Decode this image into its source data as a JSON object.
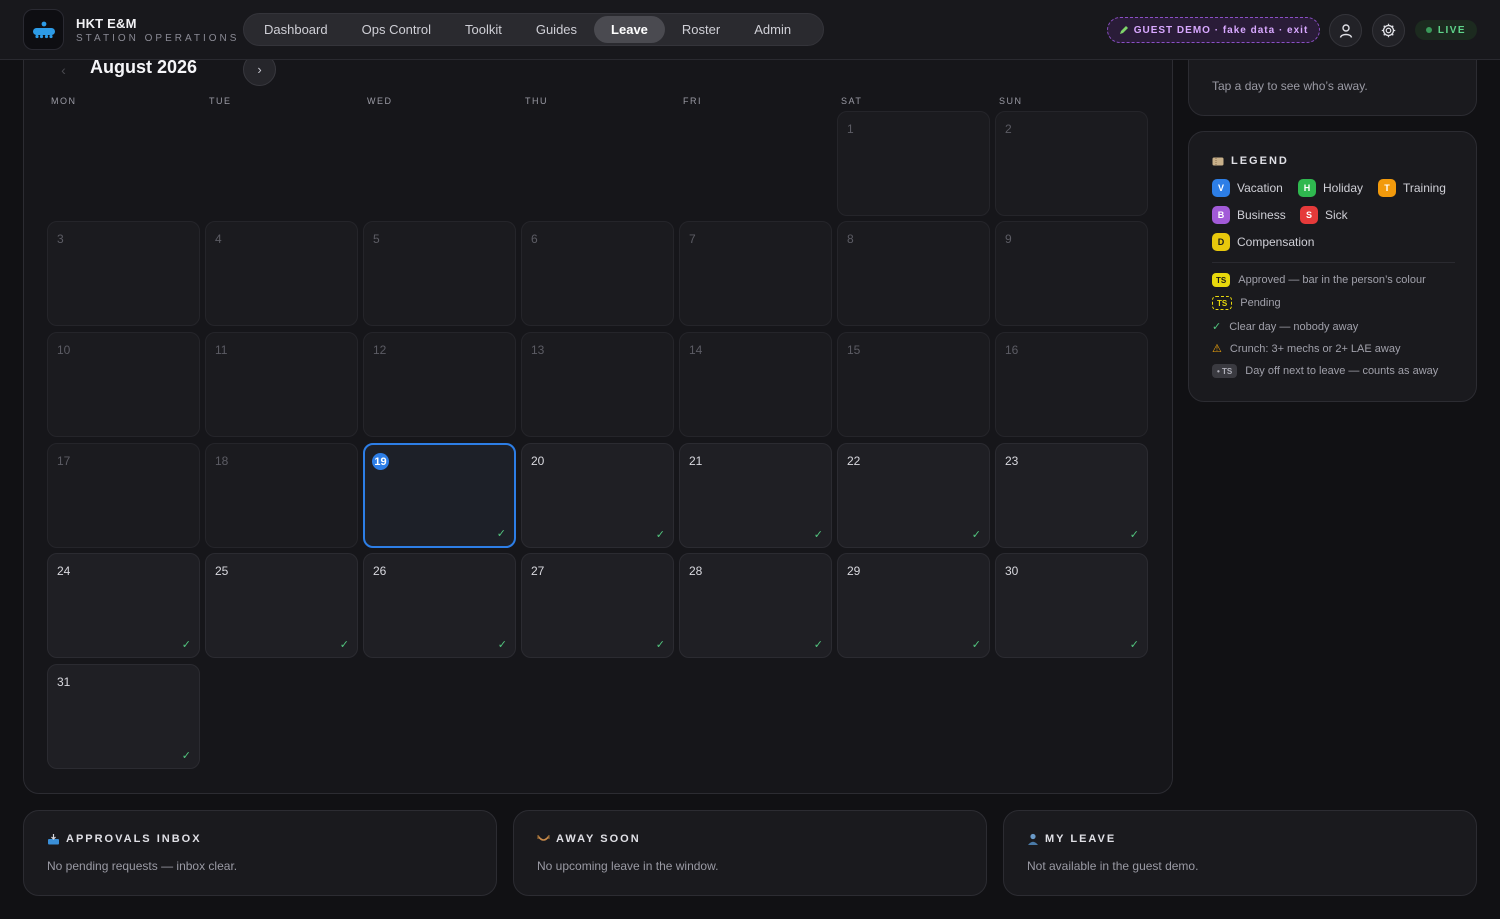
{
  "brand": {
    "title": "HKT E&M",
    "subtitle": "STATION OPERATIONS"
  },
  "nav": [
    {
      "label": "Dashboard",
      "active": false
    },
    {
      "label": "Ops Control",
      "active": false
    },
    {
      "label": "Toolkit",
      "active": false
    },
    {
      "label": "Guides",
      "active": false
    },
    {
      "label": "Leave",
      "active": true
    },
    {
      "label": "Roster",
      "active": false
    },
    {
      "label": "Admin",
      "active": false
    }
  ],
  "guest_banner": "GUEST DEMO · fake data · exit",
  "live": "LIVE",
  "calendar": {
    "month_label": "August 2026",
    "prev": "‹",
    "next": "›",
    "weekdays": [
      "MON",
      "TUE",
      "WED",
      "THU",
      "FRI",
      "SAT",
      "SUN"
    ],
    "today": 19,
    "days": [
      1,
      2,
      3,
      4,
      5,
      6,
      7,
      8,
      9,
      10,
      11,
      12,
      13,
      14,
      15,
      16,
      17,
      18,
      19,
      20,
      21,
      22,
      23,
      24,
      25,
      26,
      27,
      28,
      29,
      30,
      31
    ]
  },
  "day_detail": {
    "hint": "Tap a day to see who’s away."
  },
  "legend": {
    "title": "LEGEND",
    "types": [
      {
        "code": "V",
        "label": "Vacation",
        "color": "#2d7ee6"
      },
      {
        "code": "H",
        "label": "Holiday",
        "color": "#2fb84f"
      },
      {
        "code": "T",
        "label": "Training",
        "color": "#f29a0c"
      },
      {
        "code": "B",
        "label": "Business",
        "color": "#a25ad8"
      },
      {
        "code": "S",
        "label": "Sick",
        "color": "#e53a3a"
      },
      {
        "code": "D",
        "label": "Compensation",
        "color": "#e8c80c"
      }
    ],
    "approved_badge": "TS",
    "approved": "Approved — bar in the person’s colour",
    "pending_badge": "TS",
    "pending": "Pending",
    "clear_icon": "✓",
    "clear": "Clear day — nobody away",
    "crunch_icon": "⚠",
    "crunch": "Crunch: 3+ mechs or 2+ LAE away",
    "dayoff_badge": "• TS",
    "dayoff": "Day off next to leave — counts as away"
  },
  "cards": {
    "approvals": {
      "title": "APPROVALS INBOX",
      "text": "No pending requests — inbox clear."
    },
    "away": {
      "title": "AWAY SOON",
      "text": "No upcoming leave in the window."
    },
    "myleave": {
      "title": "MY LEAVE",
      "text": "Not available in the guest demo."
    }
  },
  "colors": {
    "accent": "#2d7ee6",
    "clear_check": "#52c47e",
    "live": "#5fd48a",
    "guest": "#d8a8ff"
  }
}
